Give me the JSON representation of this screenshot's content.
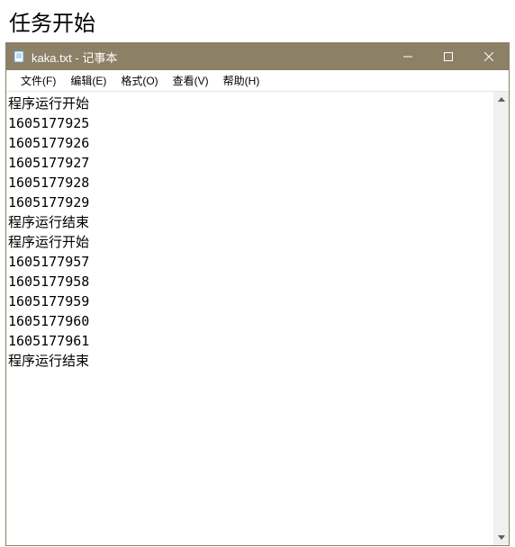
{
  "outer": {
    "header": "任务开始"
  },
  "window": {
    "title": "kaka.txt - 记事本"
  },
  "menu": {
    "file": "文件(F)",
    "edit": "编辑(E)",
    "format": "格式(O)",
    "view": "查看(V)",
    "help": "帮助(H)"
  },
  "content": {
    "lines": [
      "程序运行开始",
      "1605177925",
      "1605177926",
      "1605177927",
      "1605177928",
      "1605177929",
      "程序运行结束",
      "程序运行开始",
      "1605177957",
      "1605177958",
      "1605177959",
      "1605177960",
      "1605177961",
      "程序运行结束"
    ]
  }
}
